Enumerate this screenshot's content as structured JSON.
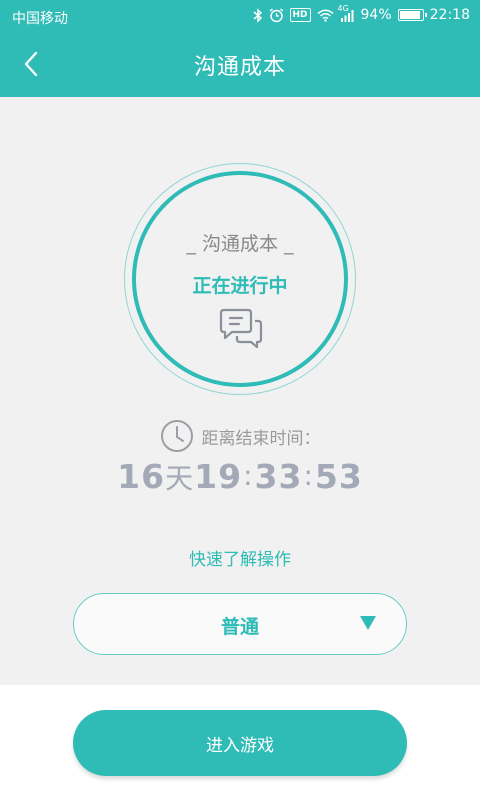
{
  "status_bar": {
    "carrier": "中国移动",
    "network": "4G",
    "hd_badge": "HD",
    "battery_percent": "94%",
    "battery_level": 0.94,
    "time": "22:18",
    "icons": [
      "bluetooth-icon",
      "alarm-icon",
      "hd-icon",
      "wifi-icon",
      "signal-icon",
      "battery-icon"
    ]
  },
  "app_bar": {
    "title": "沟通成本",
    "back_icon": "chevron-left-icon"
  },
  "game_card": {
    "title": "_ 沟通成本 _",
    "status": "正在进行中",
    "icon": "chat-bubbles-icon"
  },
  "deadline": {
    "label": "距离结束时间：",
    "icon": "clock-icon",
    "days": "16",
    "days_unit": "天",
    "hours": "19",
    "minutes": "33",
    "seconds": "53",
    "separator": ":"
  },
  "quick_guide": {
    "label": "快速了解操作"
  },
  "difficulty_select": {
    "value": "普通",
    "arrow_icon": "triangle-down-icon"
  },
  "enter_button": {
    "label": "进入游戏"
  },
  "colors": {
    "accent": "#2fbbb6",
    "background": "#f1f1f1",
    "countdown": "#a3a9b6"
  }
}
